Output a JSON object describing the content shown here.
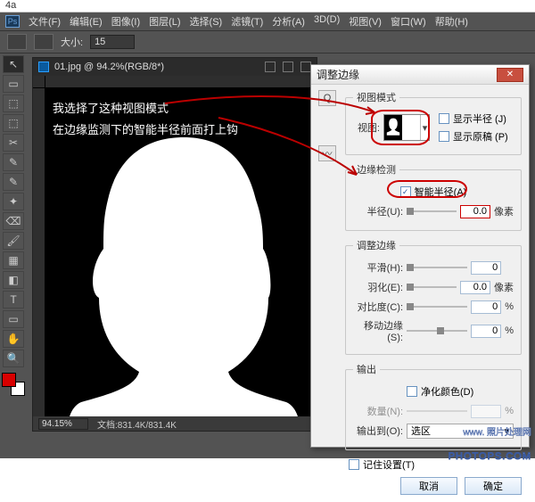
{
  "topstrip": "4a",
  "ps": {
    "logo": "Ps",
    "menu": [
      "文件(F)",
      "编辑(E)",
      "图像(I)",
      "图层(L)",
      "选择(S)",
      "滤镜(T)",
      "分析(A)",
      "3D(D)",
      "视图(V)",
      "窗口(W)",
      "帮助(H)"
    ]
  },
  "options": {
    "size_label": "大小:",
    "size_value": "15"
  },
  "toolcol": {
    "tools": [
      "↖",
      "▭",
      "⬚",
      "⬚",
      "✂",
      "✎",
      "✎",
      "✦",
      "⌫",
      "🖌",
      "▦",
      "◧",
      "T",
      "▭",
      "✋",
      "🔍"
    ]
  },
  "doc": {
    "title": "01.jpg @ 94.2%(RGB/8*)"
  },
  "annot": {
    "line1": "我选择了这种视图模式",
    "line2": "在边缘监测下的智能半径前面打上钩"
  },
  "status": {
    "zoom": "94.15%",
    "doc": "文档:831.4K/831.4K"
  },
  "dialog": {
    "title": "调整边缘",
    "close": "✕",
    "tool_q": "Q",
    "tool_brush": "〰",
    "group_view": "视图模式",
    "view_label": "视图:",
    "show_radius": "显示半径 (J)",
    "show_original": "显示原稿 (P)",
    "group_edge": "边缘检测",
    "smart_radius": "智能半径(A)",
    "smart_radius_checked": "✓",
    "radius_label": "半径(U):",
    "radius_value": "0.0",
    "px": "像素",
    "group_adjust": "调整边缘",
    "smooth_label": "平滑(H):",
    "smooth_value": "0",
    "feather_label": "羽化(E):",
    "feather_value": "0.0",
    "contrast_label": "对比度(C):",
    "contrast_value": "0",
    "shift_label": "移动边缘(S):",
    "shift_value": "0",
    "pct": "%",
    "group_output": "输出",
    "decontaminate": "净化颜色(D)",
    "amount_label": "数量(N):",
    "output_to_label": "输出到(O):",
    "output_to_value": "选区",
    "remember": "记住设置(T)",
    "ok": "确定",
    "cancel": "取消"
  },
  "watermark": {
    "small": "www.  照片处理网",
    "big": "PHOTOPS.COM"
  }
}
